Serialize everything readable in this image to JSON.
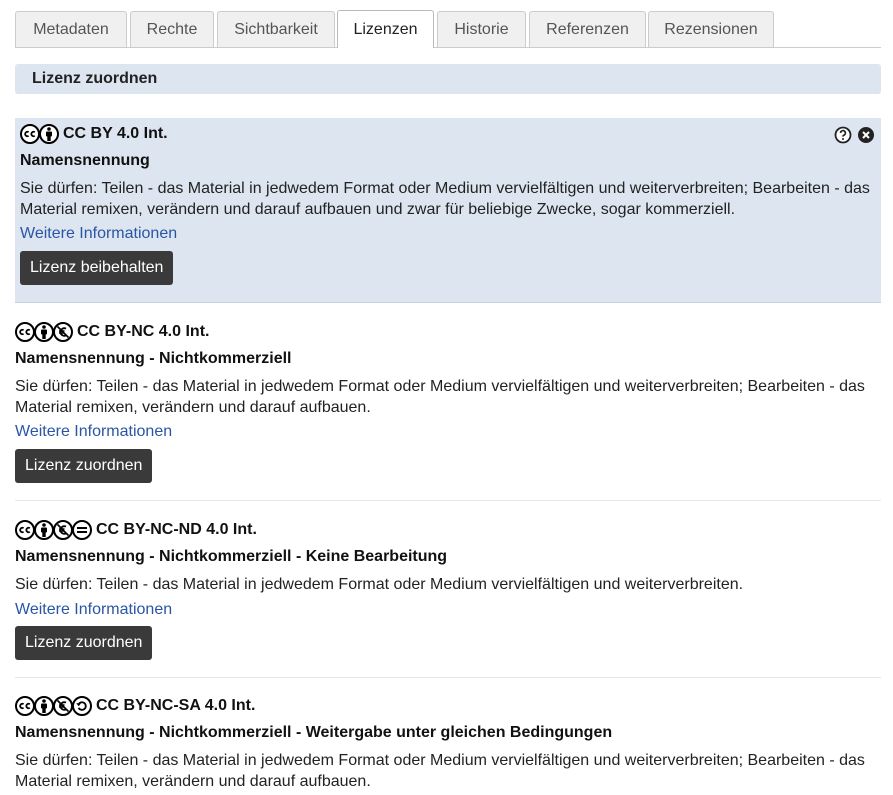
{
  "tabs": [
    {
      "label": "Metadaten"
    },
    {
      "label": "Rechte"
    },
    {
      "label": "Sichtbarkeit"
    },
    {
      "label": "Lizenzen",
      "active": true
    },
    {
      "label": "Historie"
    },
    {
      "label": "Referenzen"
    },
    {
      "label": "Rezensionen"
    }
  ],
  "section": {
    "title": "Lizenz zuordnen"
  },
  "licenses": [
    {
      "code": "CC BY 4.0 Int.",
      "icons": [
        "cc-icon",
        "by-icon"
      ],
      "title": "Namensnennung",
      "description": "Sie dürfen: Teilen - das Material in jedwedem Format oder Medium vervielfältigen und weiterverbreiten; Bearbeiten - das Material remixen, verändern und darauf aufbauen und zwar für beliebige Zwecke, sogar kommerziell.",
      "link": "Weitere Informationen",
      "button": "Lizenz beibehalten",
      "selected": true
    },
    {
      "code": "CC BY-NC 4.0 Int.",
      "icons": [
        "cc-icon",
        "by-icon",
        "nc-icon"
      ],
      "title": "Namensnennung - Nichtkommerziell",
      "description": "Sie dürfen: Teilen - das Material in jedwedem Format oder Medium vervielfältigen und weiterverbreiten; Bearbeiten - das Material remixen, verändern und darauf aufbauen.",
      "link": "Weitere Informationen",
      "button": "Lizenz zuordnen"
    },
    {
      "code": "CC BY-NC-ND 4.0 Int.",
      "icons": [
        "cc-icon",
        "by-icon",
        "nc-icon",
        "nd-icon"
      ],
      "title": "Namensnennung - Nichtkommerziell - Keine Bearbeitung",
      "description": "Sie dürfen: Teilen - das Material in jedwedem Format oder Medium vervielfältigen und weiterverbreiten.",
      "link": "Weitere Informationen",
      "button": "Lizenz zuordnen"
    },
    {
      "code": "CC BY-NC-SA 4.0 Int.",
      "icons": [
        "cc-icon",
        "by-icon",
        "nc-icon",
        "sa-icon"
      ],
      "title": "Namensnennung - Nichtkommerziell - Weitergabe unter gleichen Bedingungen",
      "description": "Sie dürfen: Teilen - das Material in jedwedem Format oder Medium vervielfältigen und weiterverbreiten; Bearbeiten - das Material remixen, verändern und darauf aufbauen."
    }
  ]
}
